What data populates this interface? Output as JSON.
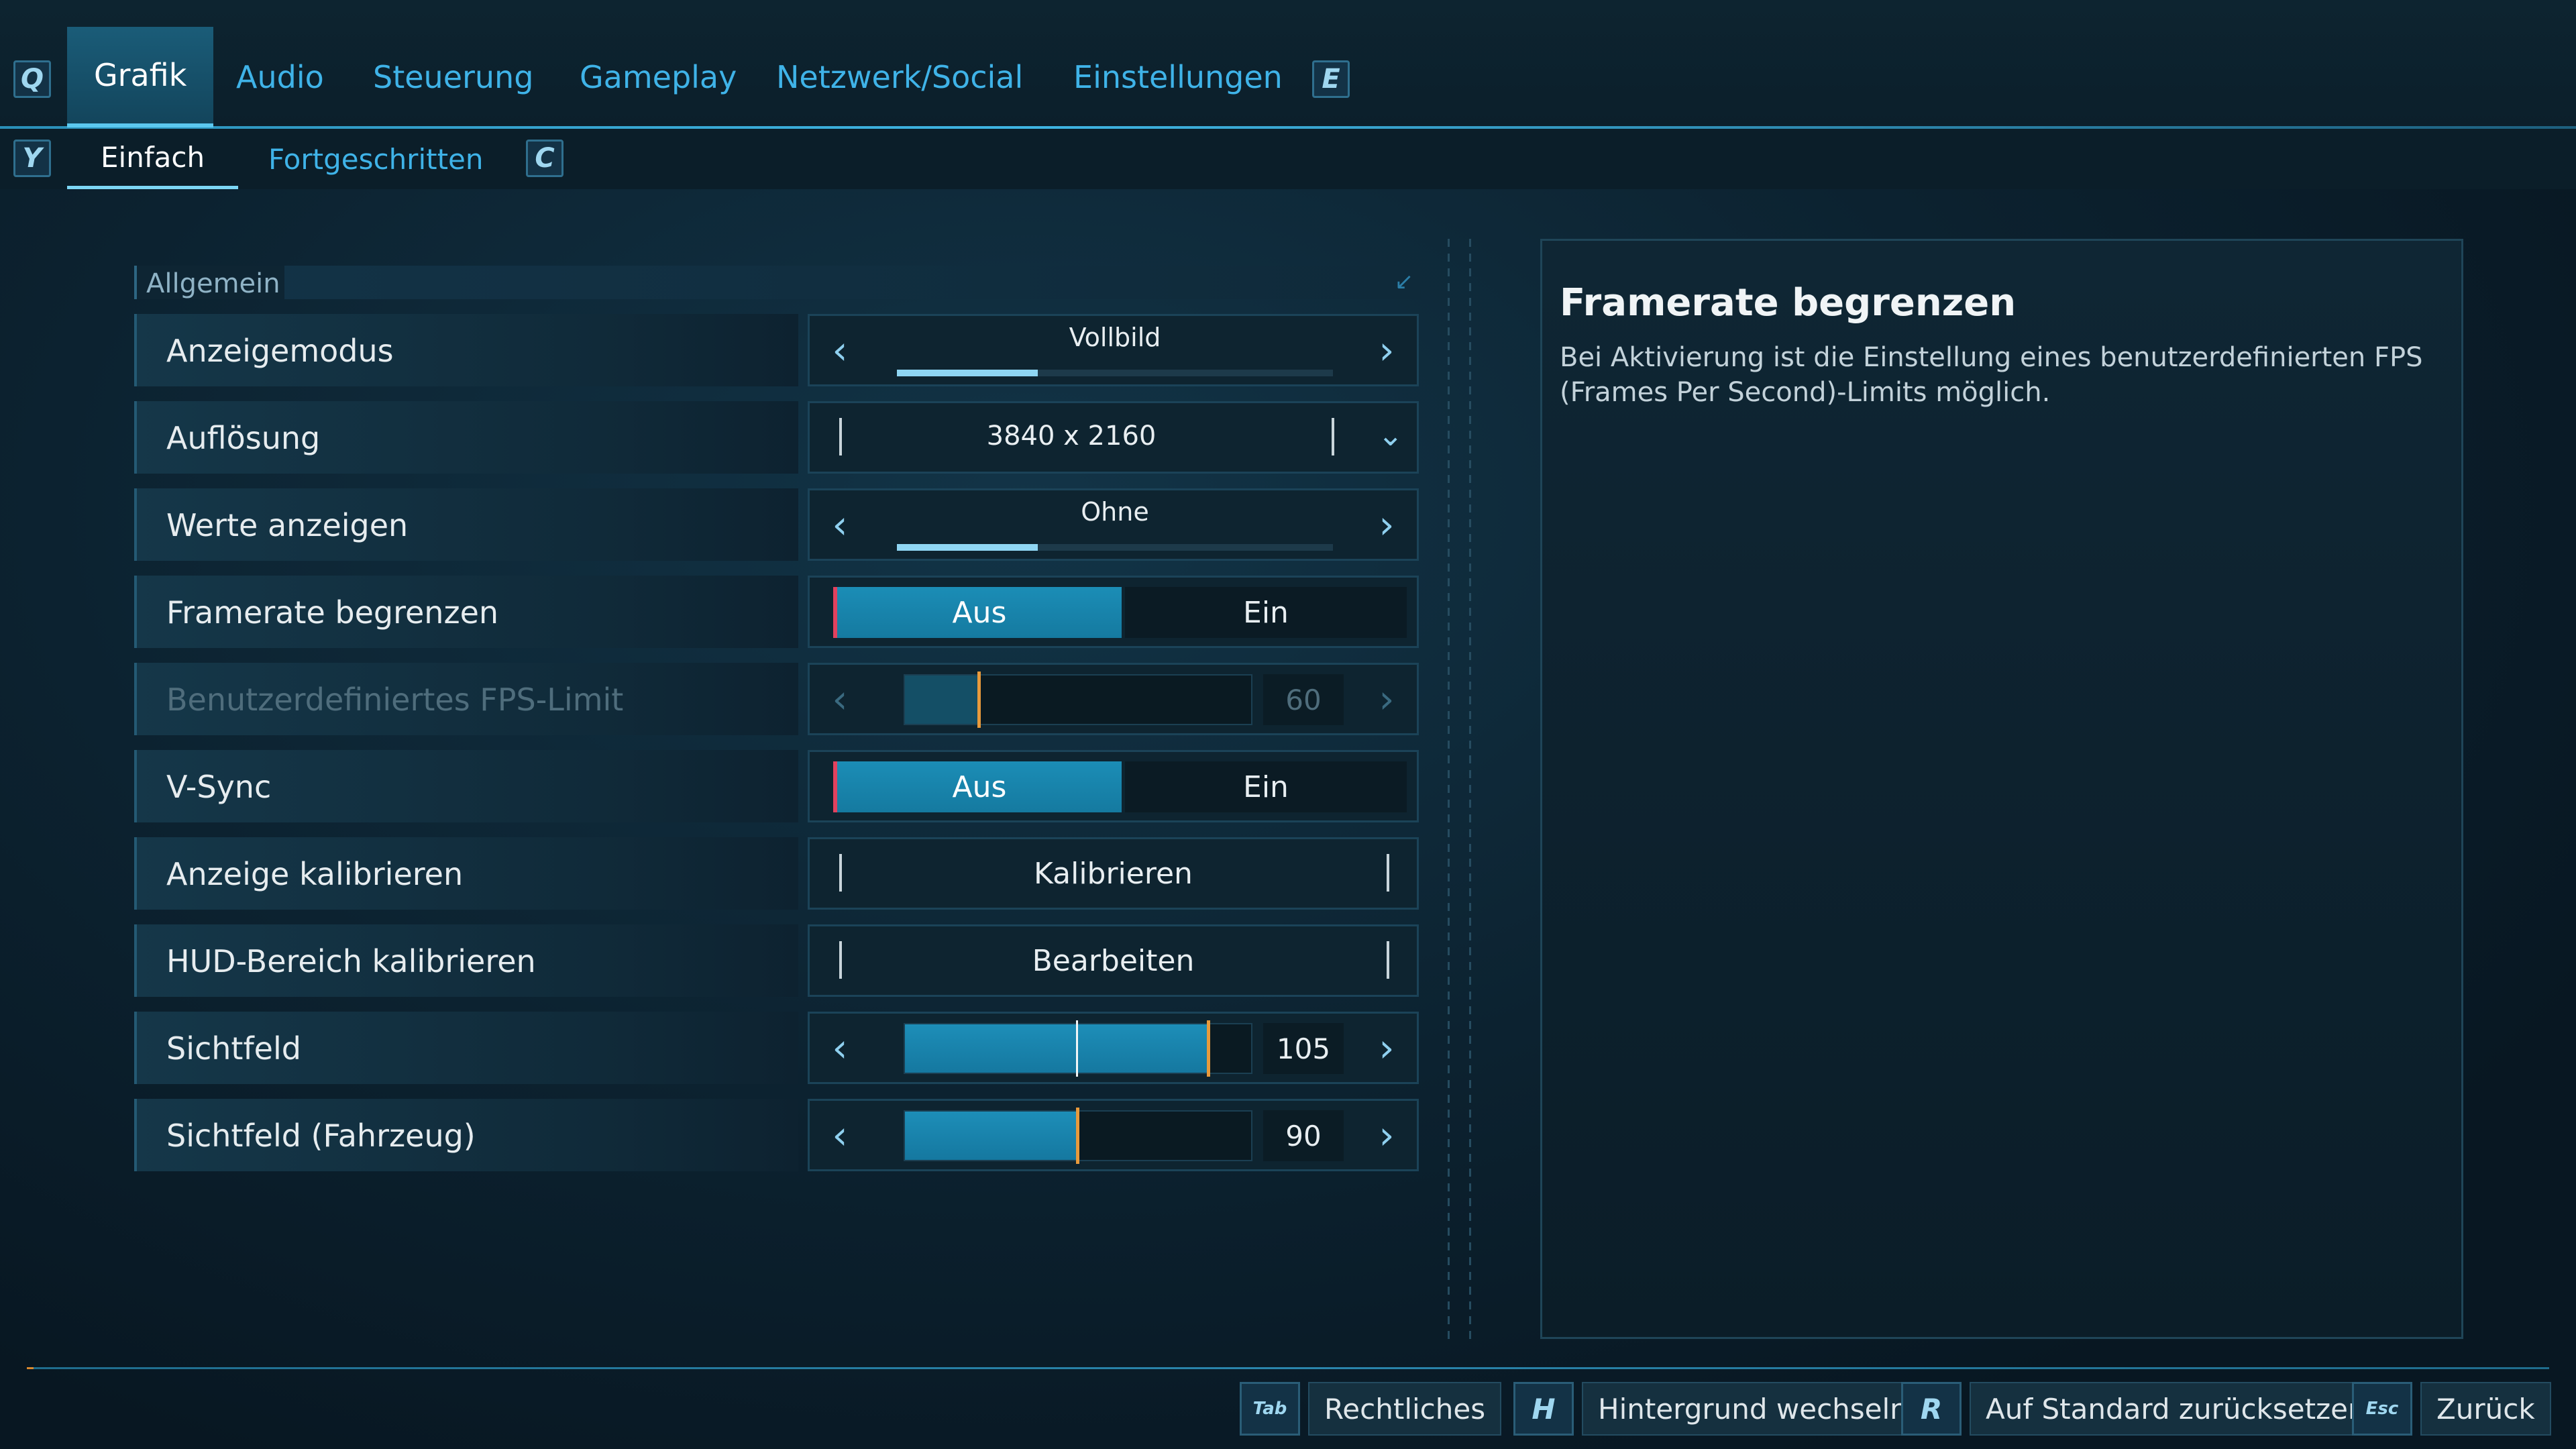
{
  "top_tabs": {
    "prev_key": "Q",
    "next_key": "E",
    "items": [
      "Grafik",
      "Audio",
      "Steuerung",
      "Gameplay",
      "Netzwerk/Social",
      "Einstellungen"
    ]
  },
  "sub_tabs": {
    "prev_key": "Y",
    "next_key": "C",
    "items": [
      "Einfach",
      "Fortgeschritten"
    ]
  },
  "section": {
    "title": "Allgemein"
  },
  "settings": {
    "display_mode": {
      "label": "Anzeigemodus",
      "value": "Vollbild"
    },
    "resolution": {
      "label": "Auflösung",
      "value": "3840 x 2160"
    },
    "show_values": {
      "label": "Werte anzeigen",
      "value": "Ohne"
    },
    "limit_framerate": {
      "label": "Framerate begrenzen",
      "off": "Aus",
      "on": "Ein"
    },
    "fps_limit": {
      "label": "Benutzerdefiniertes FPS-Limit",
      "value": "60"
    },
    "vsync": {
      "label": "V-Sync",
      "off": "Aus",
      "on": "Ein"
    },
    "calibrate_display": {
      "label": "Anzeige kalibrieren",
      "action": "Kalibrieren"
    },
    "calibrate_hud": {
      "label": "HUD-Bereich kalibrieren",
      "action": "Bearbeiten"
    },
    "fov": {
      "label": "Sichtfeld",
      "value": "105"
    },
    "fov_vehicle": {
      "label": "Sichtfeld (Fahrzeug)",
      "value": "90"
    }
  },
  "info": {
    "title": "Framerate begrenzen",
    "description": "Bei Aktivierung ist die Einstellung eines benutzerdefinierten FPS (Frames Per Second)-Limits möglich."
  },
  "bottom": {
    "legal_key": "Tab",
    "legal": "Rechtliches",
    "bg_key": "H",
    "bg": "Hintergrund wechseln",
    "reset_key": "R",
    "reset": "Auf Standard zurücksetzen",
    "back_key": "Esc",
    "back": "Zurück"
  },
  "colors": {
    "accent": "#3fb3e8",
    "active_tab": "#1a5c78",
    "toggle_on": "#1b8db6",
    "slider_thumb": "#e89a3c"
  }
}
